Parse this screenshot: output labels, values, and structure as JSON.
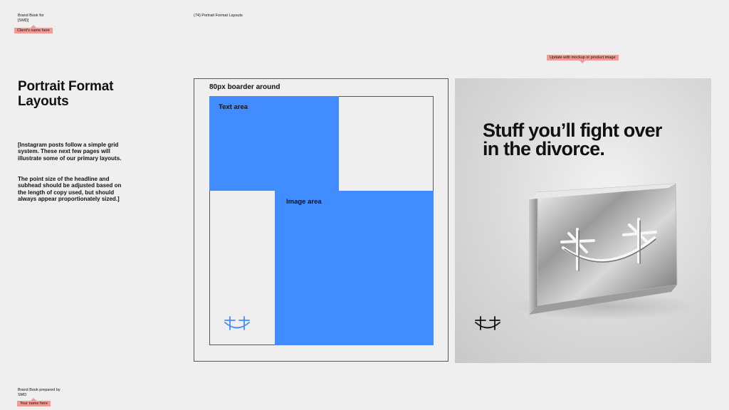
{
  "header": {
    "brand_book_for": "Brand Book for",
    "brand_name": "[SMD]",
    "client_tag": "Client's name here",
    "page_label": "(74) Portrait Format Layouts",
    "mockup_tag": "Update with mockup or product image"
  },
  "main": {
    "title_line1": "Portrait Format",
    "title_line2": "Layouts",
    "paragraph1": "[Instagram posts follow a simple grid system. These next few pages will illustrate some of our primary layouts.",
    "paragraph2": "The point size of the headline and subhead should be adjusted based on the length of copy used, but should always appear proportionately sized.]"
  },
  "diagram": {
    "border_label": "80px boarder around",
    "text_area_label": "Text area",
    "image_area_label": "Image area",
    "accent_color": "#418cff",
    "logo_icon": "smile-logo-icon"
  },
  "photo": {
    "headline_line1": "Stuff you’ll fight over",
    "headline_line2": "in the divorce.",
    "product_icon": "acrylic-block-logo-icon"
  },
  "footer": {
    "prepared_by": "Brand Book prepared by",
    "prepared_brand": "SMD",
    "name_tag": "Your name here"
  }
}
